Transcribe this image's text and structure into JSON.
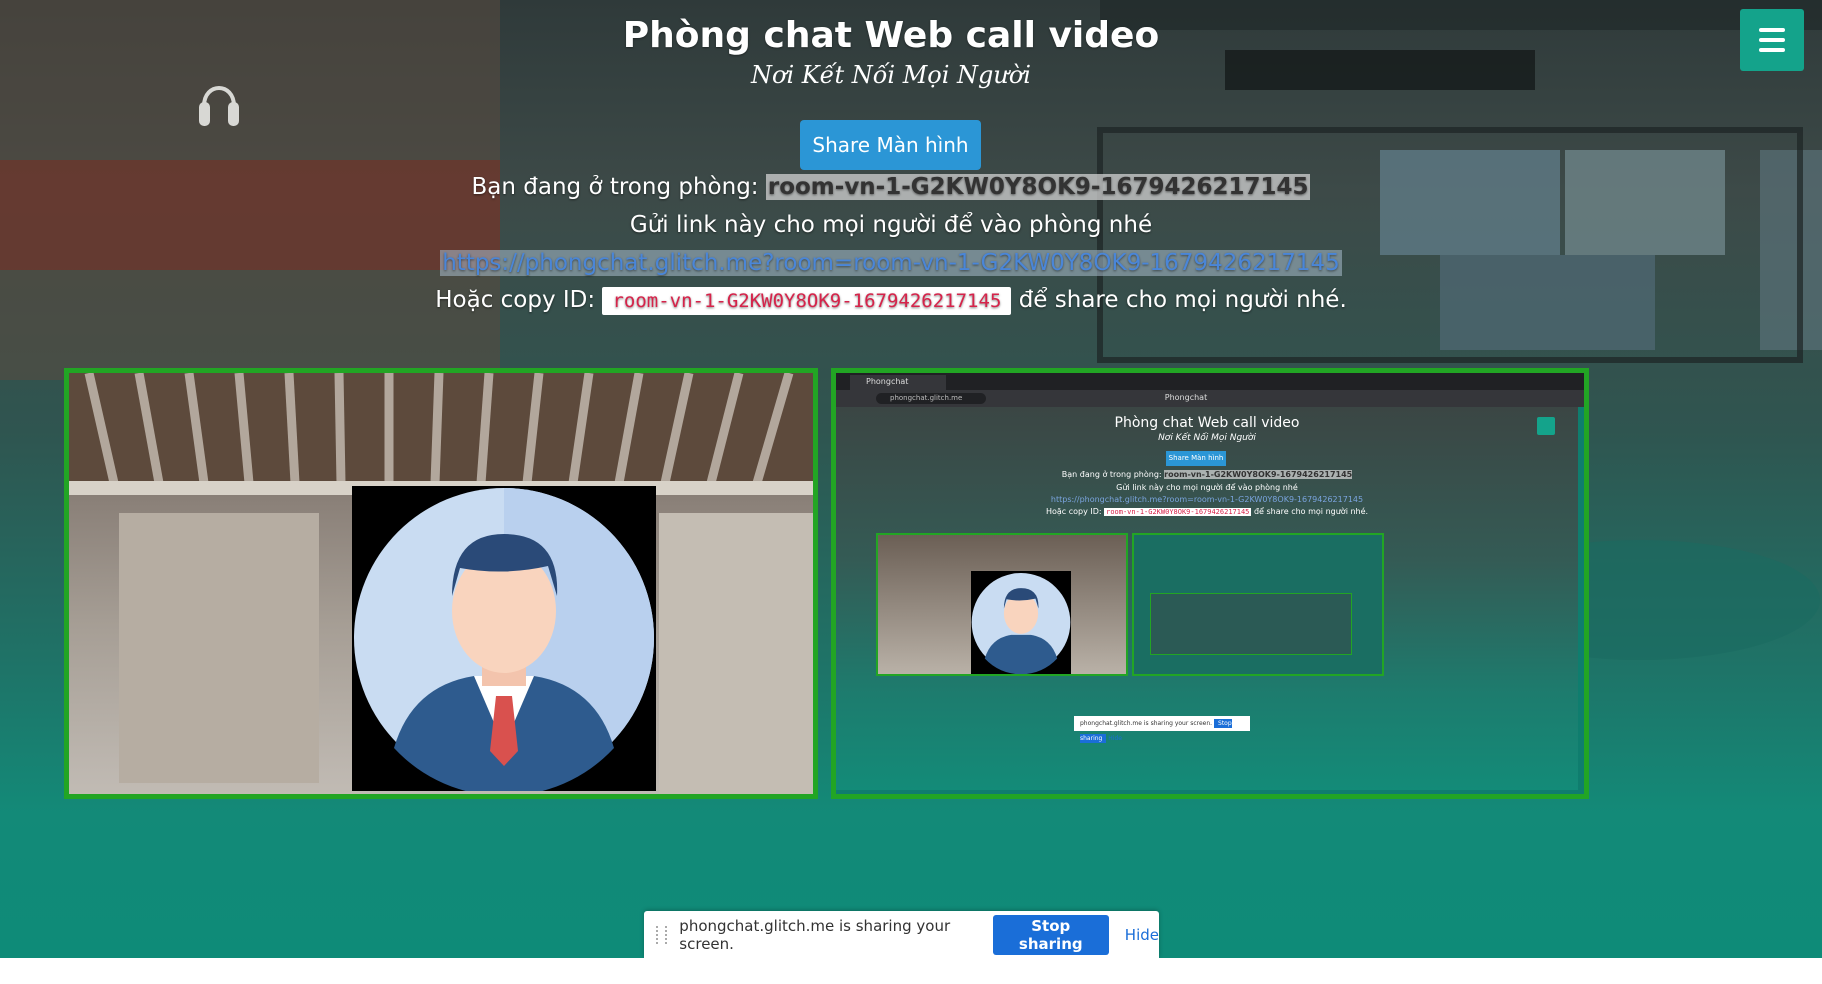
{
  "header": {
    "title": "Phòng chat Web call video",
    "subtitle": "Nơi Kết Nối Mọi Người"
  },
  "share_button_label": "Share Màn hình",
  "room": {
    "prefix": "Bạn đang ở trong phòng:",
    "id": "room-vn-1-G2KW0Y8OK9-1679426217145",
    "invite_text": "Gửi link này cho mọi người để vào phòng nhé",
    "link": "https://phongchat.glitch.me?room=room-vn-1-G2KW0Y8OK9-1679426217145",
    "copy_prefix": "Hoặc copy ID:",
    "copy_id": "room-vn-1-G2KW0Y8OK9-1679426217145",
    "copy_suffix": "để share cho mọi người nhé."
  },
  "screen_share_bar": {
    "message": "phongchat.glitch.me is sharing your screen.",
    "stop_label": "Stop sharing",
    "hide_label": "Hide"
  },
  "shared_screen": {
    "tab_title": "Phongchat",
    "address": "phongchat.glitch.me",
    "window_title": "Phongchat"
  },
  "icons": {
    "menu": "hamburger-icon",
    "headphones": "headphones-icon",
    "avatar": "user-avatar-icon"
  },
  "colors": {
    "accent": "#14a38b",
    "video_border": "#22a524",
    "share_button": "#2b96d6",
    "stop_button": "#1a6ed8",
    "code": "#d6234a"
  }
}
